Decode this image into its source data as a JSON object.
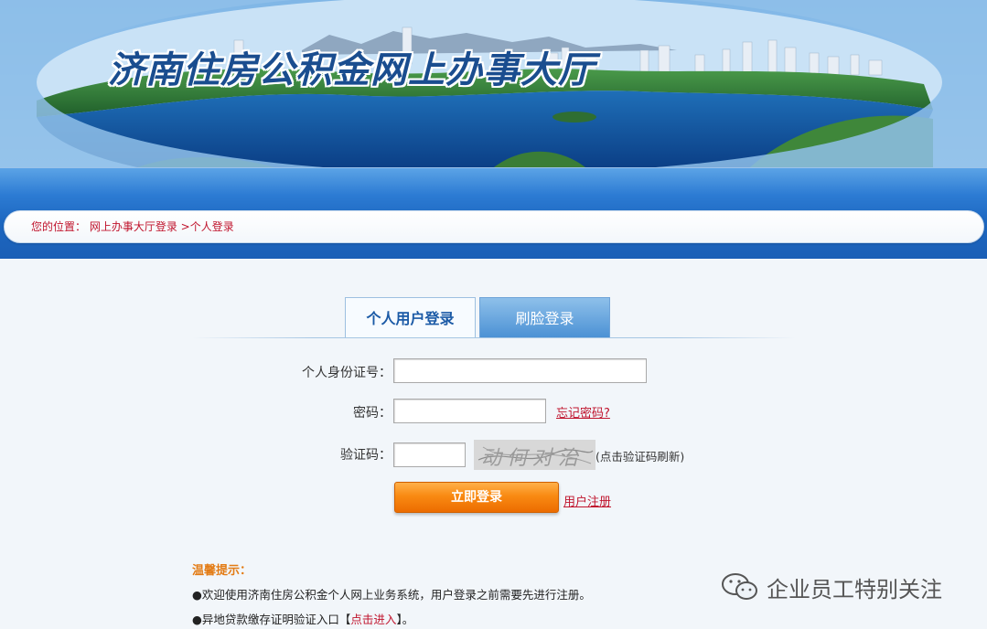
{
  "banner": {
    "title": "济南住房公积金网上办事大厅"
  },
  "breadcrumb": {
    "prefix": "您的位置：",
    "path": "网上办事大厅登录 >个人登录"
  },
  "tabs": [
    {
      "label": "个人用户登录",
      "active": true
    },
    {
      "label": "刷脸登录",
      "active": false
    }
  ],
  "form": {
    "id_label": "个人身份证号：",
    "id_value": "",
    "password_label": "密码：",
    "password_value": "",
    "forgot_link": "忘记密码?",
    "captcha_label": "验证码：",
    "captcha_value": "",
    "captcha_text": "动何对治",
    "captcha_hint": "(点击验证码刷新)",
    "login_button": "立即登录",
    "register_link": "用户注册"
  },
  "tips": {
    "title": "温馨提示：",
    "line1": "●欢迎使用济南住房公积金个人网上业务系统，用户登录之前需要先进行注册。",
    "line2_prefix": "●异地贷款缴存证明验证入口【",
    "line2_link": "点击进入",
    "line2_suffix": "】。"
  },
  "watermark": {
    "text": "企业员工特别关注",
    "icon": "wechat-icon"
  },
  "colors": {
    "nav_blue": "#1d67c0",
    "accent_orange": "#f98a12",
    "link_red": "#c0142d",
    "tip_orange": "#e37b14"
  }
}
